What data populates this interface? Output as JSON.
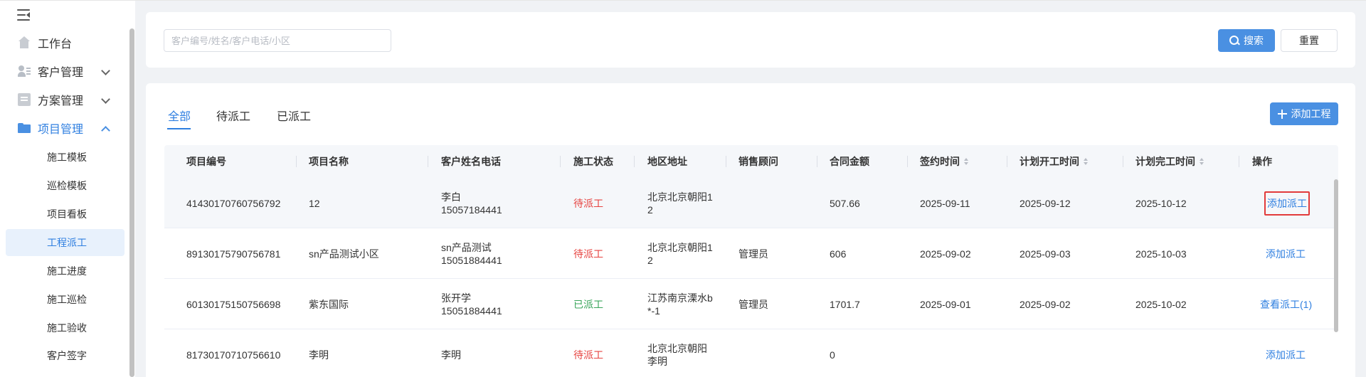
{
  "sidebar": {
    "menu": [
      {
        "label": "工作台"
      },
      {
        "label": "客户管理"
      },
      {
        "label": "方案管理"
      },
      {
        "label": "项目管理"
      }
    ],
    "submenu": [
      {
        "label": "施工模板"
      },
      {
        "label": "巡检模板"
      },
      {
        "label": "项目看板"
      },
      {
        "label": "工程派工"
      },
      {
        "label": "施工进度"
      },
      {
        "label": "施工巡检"
      },
      {
        "label": "施工验收"
      },
      {
        "label": "客户签字"
      }
    ],
    "active_sub": "工程派工"
  },
  "search": {
    "placeholder": "客户编号/姓名/客户电话/小区",
    "value": "",
    "search_label": "搜索",
    "reset_label": "重置"
  },
  "tabs": [
    {
      "label": "全部",
      "active": true
    },
    {
      "label": "待派工",
      "active": false
    },
    {
      "label": "已派工",
      "active": false
    }
  ],
  "add_button": "添加工程",
  "table": {
    "columns": [
      "项目编号",
      "项目名称",
      "客户姓名电话",
      "施工状态",
      "地区地址",
      "销售顾问",
      "合同金额",
      "签约时间",
      "计划开工时间",
      "计划完工时间",
      "操作"
    ],
    "rows": [
      {
        "id": "41430170760756792",
        "name": "12",
        "customer": "李白",
        "phone": "15057184441",
        "status": "待派工",
        "addr1": "北京北京朝阳1",
        "addr2": "2",
        "sales": "",
        "amount": "507.66",
        "sign": "2025-09-11",
        "start": "2025-09-12",
        "end": "2025-10-12",
        "op": "添加派工"
      },
      {
        "id": "89130175790756781",
        "name": "sn产品测试小区",
        "customer": "sn产品测试",
        "phone": "15051884441",
        "status": "待派工",
        "addr1": "北京北京朝阳1",
        "addr2": "2",
        "sales": "管理员",
        "amount": "606",
        "sign": "2025-09-02",
        "start": "2025-09-03",
        "end": "2025-10-03",
        "op": "添加派工"
      },
      {
        "id": "60130175150756698",
        "name": "紫东国际",
        "customer": "张开学",
        "phone": "15051884441",
        "status": "已派工",
        "addr1": "江苏南京溧水b",
        "addr2": "*-1",
        "sales": "管理员",
        "amount": "1701.7",
        "sign": "2025-09-01",
        "start": "2025-09-02",
        "end": "2025-10-02",
        "op": "查看派工(1)"
      },
      {
        "id": "81730170710756610",
        "name": "李明",
        "customer": "李明",
        "phone": "",
        "status": "待派工",
        "addr1": "北京北京朝阳",
        "addr2": "李明",
        "sales": "",
        "amount": "0",
        "sign": "",
        "start": "",
        "end": "",
        "op": "添加派工"
      }
    ]
  },
  "colors": {
    "primary": "#4a90e2",
    "pending": "#e64340",
    "dispatched": "#3aa55b",
    "highlight": "#e23b3b"
  }
}
